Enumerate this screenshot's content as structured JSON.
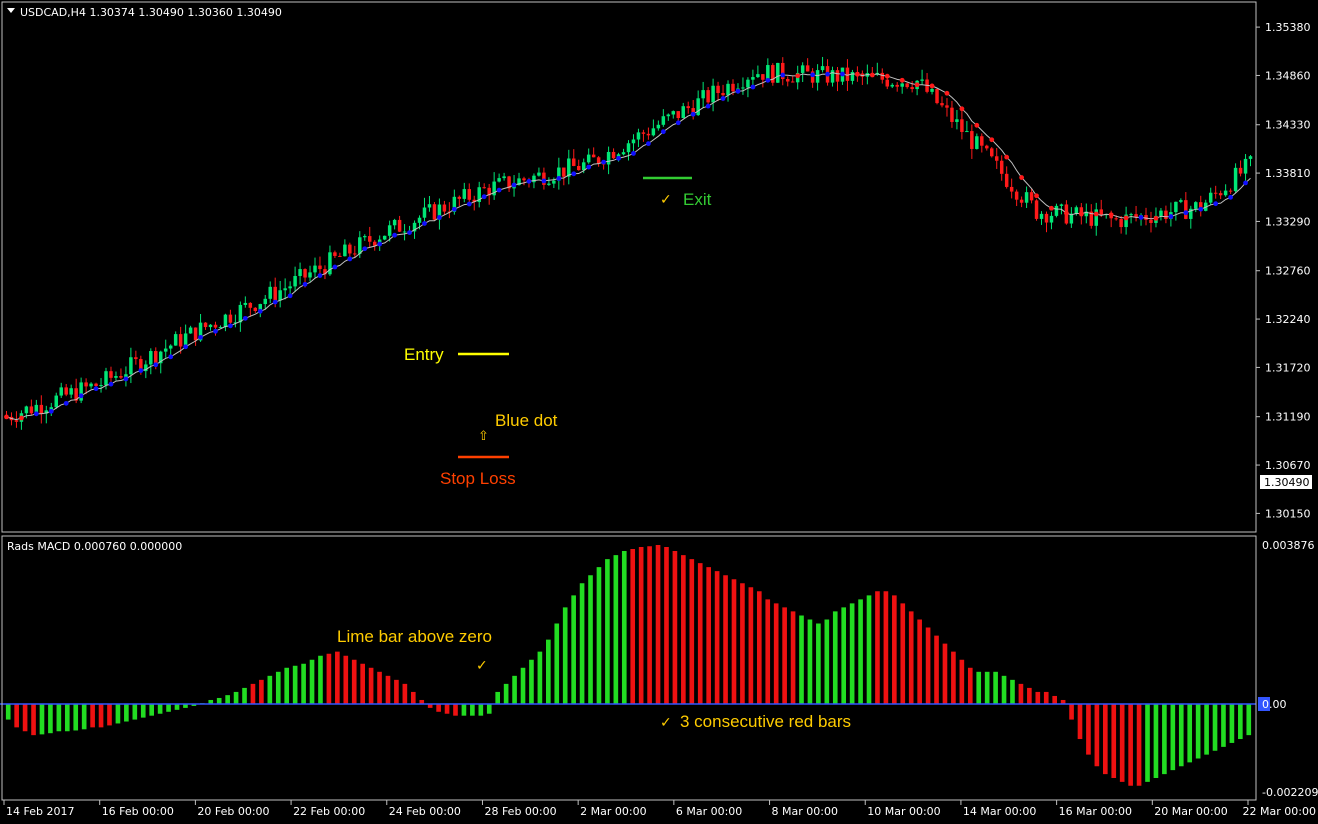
{
  "header": {
    "symbol_info": "USDCAD,H4  1.30374 1.30490 1.30360 1.30490",
    "indicator_info": "Rads MACD 0.000760 0.000000"
  },
  "colors": {
    "background": "#000000",
    "bull": "#00e676",
    "bear": "#ff1a1a",
    "ma_up": "#1010ff",
    "ma_down": "#ff1a1a",
    "hist_green": "#22dd22",
    "hist_red": "#ee1111",
    "zero_line": "#3355ff",
    "grid_frame": "#c0c0c0",
    "entry": "#ffff00",
    "stop": "#ff4000",
    "exit": "#33cc33",
    "annotation": "#ffcc00"
  },
  "chart_data": [
    {
      "type": "candlestick",
      "symbol": "USDCAD",
      "timeframe": "H4",
      "last_price_label": "1.30490",
      "yticks": [
        "1.35380",
        "1.34860",
        "1.34330",
        "1.33810",
        "1.33290",
        "1.32760",
        "1.32240",
        "1.31720",
        "1.31190",
        "1.30670",
        "1.30150"
      ],
      "ylim": [
        1.2995,
        1.3565
      ],
      "key_levels": [
        1.3119,
        1.3155,
        1.3205,
        1.3255,
        1.3315,
        1.3365,
        1.3391,
        1.3445,
        1.349,
        1.348,
        1.334,
        1.333,
        1.3345,
        1.339
      ],
      "key_level_index": [
        0,
        19,
        36,
        55,
        75,
        97,
        117,
        135,
        150,
        183,
        207,
        223,
        240,
        250
      ]
    },
    {
      "type": "histogram",
      "title": "Rads MACD",
      "yticks": [
        "0.003876",
        "0.00",
        "-0.002209"
      ],
      "ylim": [
        -0.002209,
        0.003876
      ],
      "values": [
        -0.0004,
        -0.0006,
        -0.0007,
        -0.0008,
        -0.00078,
        -0.00075,
        -0.0007,
        -0.0007,
        -0.00068,
        -0.00065,
        -0.0006,
        -0.0006,
        -0.00055,
        -0.0005,
        -0.00045,
        -0.0004,
        -0.00035,
        -0.0003,
        -0.00025,
        -0.0002,
        -0.00015,
        -0.0001,
        -5e-05,
        2e-05,
        0.0001,
        0.00015,
        0.00022,
        0.0003,
        0.0004,
        0.0005,
        0.0006,
        0.0007,
        0.0008,
        0.0009,
        0.00095,
        0.001,
        0.0011,
        0.0012,
        0.00125,
        0.0013,
        0.0012,
        0.0011,
        0.001,
        0.0009,
        0.0008,
        0.0007,
        0.0006,
        0.0005,
        0.0003,
        0.0001,
        -0.0001,
        -0.0002,
        -0.00025,
        -0.0003,
        -0.0003,
        -0.0003,
        -0.0003,
        -0.00025,
        0.0003,
        0.0005,
        0.0007,
        0.0009,
        0.0011,
        0.0013,
        0.0016,
        0.002,
        0.0024,
        0.0027,
        0.003,
        0.0032,
        0.0034,
        0.0036,
        0.0037,
        0.0038,
        0.00385,
        0.0039,
        0.00392,
        0.00395,
        0.0039,
        0.0038,
        0.0037,
        0.0036,
        0.0035,
        0.0034,
        0.0033,
        0.0032,
        0.0031,
        0.003,
        0.0029,
        0.0028,
        0.0026,
        0.0025,
        0.0024,
        0.0023,
        0.0022,
        0.0021,
        0.002,
        0.0021,
        0.0023,
        0.0024,
        0.0025,
        0.0026,
        0.0027,
        0.0028,
        0.0028,
        0.0027,
        0.0025,
        0.0023,
        0.0021,
        0.0019,
        0.0017,
        0.0015,
        0.0013,
        0.0011,
        0.0009,
        0.0008,
        0.0008,
        0.0008,
        0.0007,
        0.0006,
        0.0005,
        0.0004,
        0.0003,
        0.0003,
        0.0002,
        0.0001,
        -0.0004,
        -0.0009,
        -0.0013,
        -0.0016,
        -0.0018,
        -0.0019,
        -0.002,
        -0.0021,
        -0.0021,
        -0.002,
        -0.0019,
        -0.0018,
        -0.0017,
        -0.0016,
        -0.0015,
        -0.0014,
        -0.0013,
        -0.0012,
        -0.0011,
        -0.001,
        -0.0009,
        -0.0008
      ],
      "colors_code": "GRRRGGGGGGRRRGGGGGGGGGGGGGGGGRRGGGGGGGRRRRRRRRRRRRRRRRGGGGGGGGGGGGGGGGGGGGRRRRRRRRRRRRRRRRRRRRGGGGGGGGGRRRRRRRRRRRRGGGGGRRRRRRRRRRRRRRRGGGGGGGGGGGGGGG"
    }
  ],
  "xaxis": {
    "labels": [
      "14 Feb 2017",
      "16 Feb 00:00",
      "20 Feb 00:00",
      "22 Feb 00:00",
      "24 Feb 00:00",
      "28 Feb 00:00",
      "2 Mar 00:00",
      "6 Mar 00:00",
      "8 Mar 00:00",
      "10 Mar 00:00",
      "14 Mar 00:00",
      "16 Mar 00:00",
      "20 Mar 00:00",
      "22 Mar 00:00"
    ]
  },
  "annotations": {
    "entry": "Entry",
    "blue_dot": "Blue dot",
    "stop_loss": "Stop Loss",
    "exit": "Exit",
    "lime_bar": "Lime bar above zero",
    "red_bars": "3 consecutive red bars",
    "check": "✓",
    "arrow": "⇧"
  }
}
